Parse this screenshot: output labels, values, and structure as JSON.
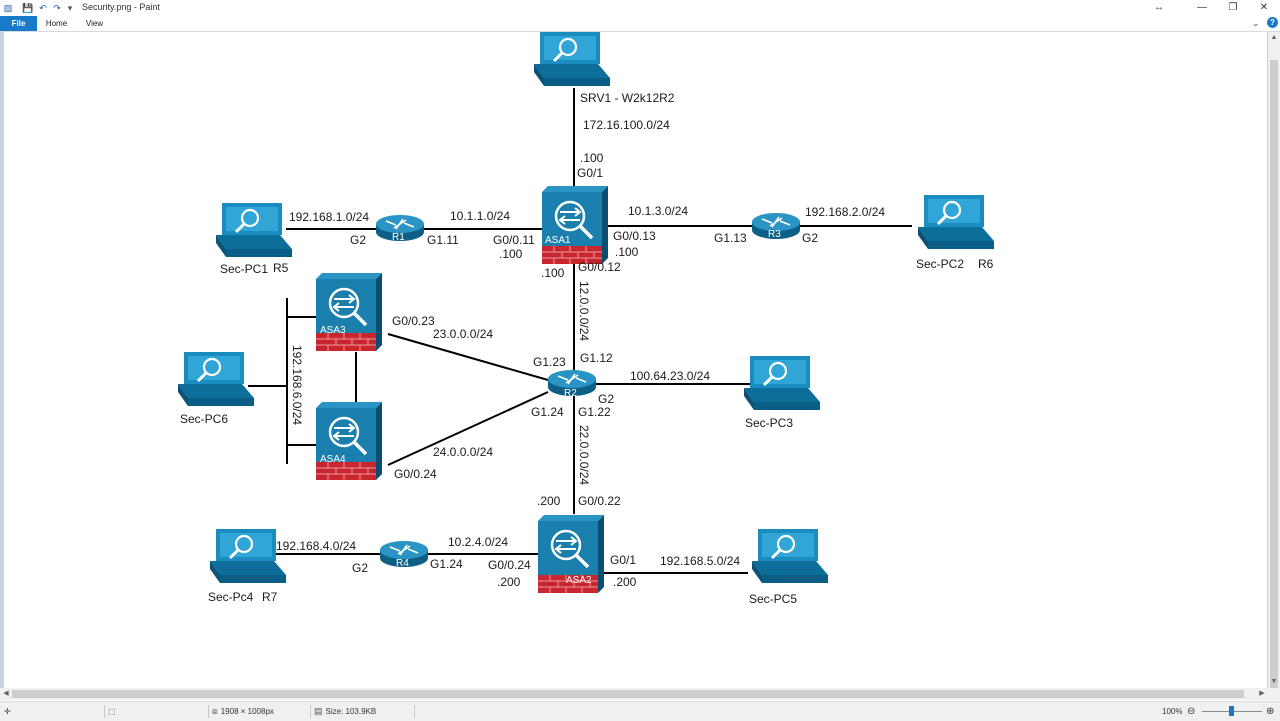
{
  "window": {
    "title": "Security.png - Paint",
    "controls": [
      "—",
      "❐",
      "✕"
    ],
    "resize_glyph": "↔"
  },
  "ribbon": {
    "tabs": [
      "File",
      "Home",
      "View"
    ],
    "expand_glyph": "⌄",
    "help_glyph": "?"
  },
  "diagram": {
    "devices": {
      "srv1": {
        "label": "SRV1 - W2k12R2"
      },
      "asa1": {
        "label": "ASA1"
      },
      "asa2": {
        "label": "ASA2"
      },
      "asa3": {
        "label": "ASA3"
      },
      "asa4": {
        "label": "ASA4"
      },
      "r1": {
        "label": "R1"
      },
      "r2": {
        "label": "R2"
      },
      "r3": {
        "label": "R3"
      },
      "r4": {
        "label": "R4"
      },
      "pc1": {
        "label": "Sec-PC1",
        "extra": "R5"
      },
      "pc2": {
        "label": "Sec-PC2",
        "extra": "R6"
      },
      "pc3": {
        "label": "Sec-PC3"
      },
      "pc4": {
        "label": "Sec-Pc4",
        "extra": "R7"
      },
      "pc5": {
        "label": "Sec-PC5"
      },
      "pc6": {
        "label": "Sec-PC6"
      }
    },
    "networks": {
      "srv_net": "172.16.100.0/24",
      "r1_pc1": "192.168.1.0/24",
      "r1_asa1": "10.1.1.0/24",
      "asa1_r3": "10.1.3.0/24",
      "r3_pc2": "192.168.2.0/24",
      "asa1_r2": "12.0.0.0/24",
      "asa3_r2": "23.0.0.0/24",
      "asa4_r2": "24.0.0.0/24",
      "r2_pc3": "100.64.23.0/24",
      "lan6": "192.168.6.0/24",
      "r2_asa2": "22.0.0.0/24",
      "pc4_r4": "192.168.4.0/24",
      "r4_asa2": "10.2.4.0/24",
      "asa2_pc5": "192.168.5.0/24"
    },
    "interfaces": {
      "asa1_srv_ip": ".100",
      "asa1_g01": "G0/1",
      "r1_g2": "G2",
      "r1_g111": "G1.11",
      "asa1_g011": "G0/0.11",
      "asa1_ip_left": ".100",
      "asa1_g013": "G0/0.13",
      "asa1_ip_right": ".100",
      "asa1_ip_bottom": ".100",
      "asa1_g012": "G0/0.12",
      "r3_g113": "G1.13",
      "r3_g2": "G2",
      "asa3_g023": "G0/0.23",
      "asa4_g024": "G0/0.24",
      "r2_g123": "G1.23",
      "r2_g112": "G1.12",
      "r2_g124": "G1.24",
      "r2_g2": "G2",
      "r2_g122": "G1.22",
      "asa2_ip_top": ".200",
      "asa2_g022": "G0/0.22",
      "r4_g2": "G2",
      "r4_g124": "G1.24",
      "asa2_g024": "G0/0.24",
      "asa2_ip_left": ".200",
      "asa2_g01": "G0/1",
      "asa2_ip_right": ".200"
    }
  },
  "statusbar": {
    "dimensions": "1908 × 1008px",
    "size": "Size: 103.9KB",
    "zoom": "100%",
    "zoom_minus": "⊖",
    "zoom_plus": "⊕"
  }
}
